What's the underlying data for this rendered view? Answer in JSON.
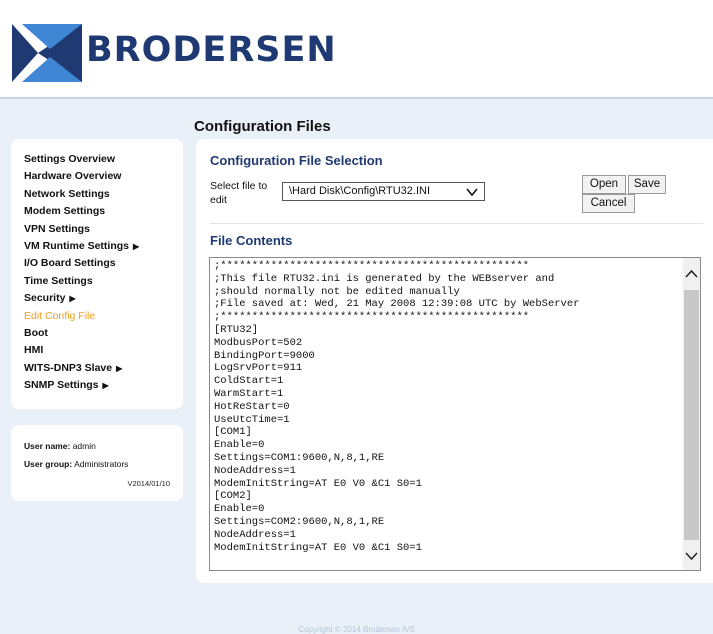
{
  "brand": {
    "name": "BRODERSEN"
  },
  "page": {
    "title": "Configuration Files"
  },
  "sidebar": {
    "items": [
      {
        "label": "Settings Overview",
        "has_submenu": false,
        "active": false
      },
      {
        "label": "Hardware Overview",
        "has_submenu": false,
        "active": false
      },
      {
        "label": "Network Settings",
        "has_submenu": false,
        "active": false
      },
      {
        "label": "Modem Settings",
        "has_submenu": false,
        "active": false
      },
      {
        "label": "VPN Settings",
        "has_submenu": false,
        "active": false
      },
      {
        "label": "VM Runtime Settings",
        "has_submenu": true,
        "active": false
      },
      {
        "label": "I/O Board Settings",
        "has_submenu": false,
        "active": false
      },
      {
        "label": "Time Settings",
        "has_submenu": false,
        "active": false
      },
      {
        "label": "Security",
        "has_submenu": true,
        "active": false
      },
      {
        "label": "Edit Config File",
        "has_submenu": false,
        "active": true
      },
      {
        "label": "Boot",
        "has_submenu": false,
        "active": false
      },
      {
        "label": "HMI",
        "has_submenu": false,
        "active": false
      },
      {
        "label": "WITS-DNP3 Slave",
        "has_submenu": true,
        "active": false
      },
      {
        "label": "SNMP Settings",
        "has_submenu": true,
        "active": false
      }
    ],
    "active_color": "#f0a01e"
  },
  "user": {
    "name_label": "User name:",
    "name_value": "admin",
    "group_label": "User group:",
    "group_value": "Administrators",
    "version": "V2014/01/10"
  },
  "selection": {
    "title": "Configuration File Selection",
    "select_label": "Select file to edit",
    "selected_file": "\\Hard Disk\\Config\\RTU32.INI",
    "open_label": "Open",
    "save_label": "Save",
    "cancel_label": "Cancel"
  },
  "contents": {
    "title": "File Contents",
    "lines": [
      ";*************************************************",
      ";This file RTU32.ini is generated by the WEBserver and",
      ";should normally not be edited manually",
      ";File saved at: Wed, 21 May 2008 12:39:08 UTC by WebServer",
      ";*************************************************",
      "[RTU32]",
      "ModbusPort=502",
      "BindingPort=9000",
      "LogSrvPort=911",
      "ColdStart=1",
      "WarmStart=1",
      "HotReStart=0",
      "UseUtcTime=1",
      "[COM1]",
      "Enable=0",
      "Settings=COM1:9600,N,8,1,RE",
      "NodeAddress=1",
      "ModemInitString=AT E0 V0 &C1 S0=1",
      "[COM2]",
      "Enable=0",
      "Settings=COM2:9600,N,8,1,RE",
      "NodeAddress=1",
      "ModemInitString=AT E0 V0 &C1 S0=1"
    ]
  },
  "footer": {
    "copyright": "Copyright © 2014 Brodersen A/S"
  },
  "colors": {
    "brand_blue": "#1f3a73",
    "logo_light": "#3f86d4",
    "background": "#eaf0f7"
  }
}
